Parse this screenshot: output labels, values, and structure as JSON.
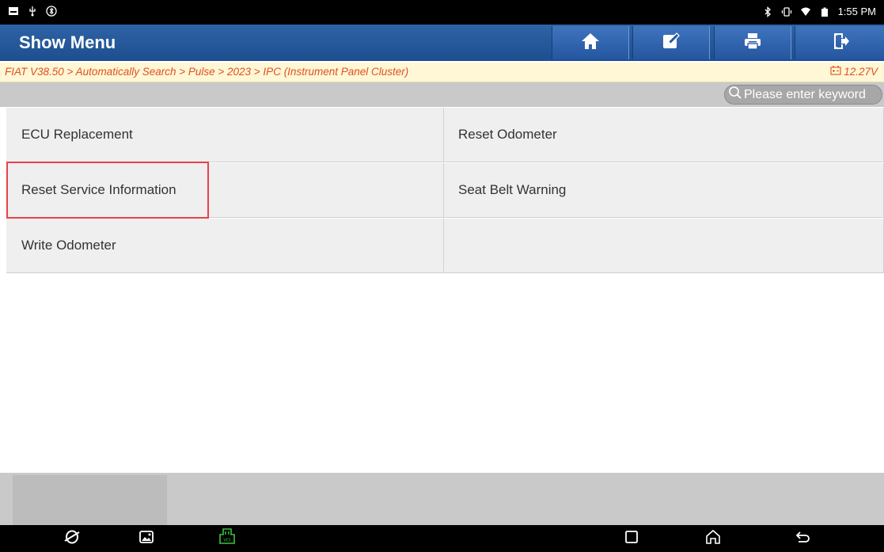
{
  "status_bar": {
    "time": "1:55 PM",
    "left_icons": [
      "notification-icon",
      "usb-icon",
      "bluetooth-circle-icon"
    ],
    "right_icons": [
      "bluetooth-icon",
      "vibrate-icon",
      "wifi-icon",
      "battery-icon"
    ]
  },
  "title_bar": {
    "title": "Show Menu",
    "buttons": [
      "home-icon",
      "edit-icon",
      "print-icon",
      "exit-icon"
    ]
  },
  "breadcrumb": {
    "path": "FIAT V38.50 > Automatically Search > Pulse > 2023 > IPC (Instrument Panel Cluster)",
    "voltage": "12.27V"
  },
  "search": {
    "placeholder": "Please enter keyword"
  },
  "menu": {
    "items": [
      "ECU Replacement",
      "Reset Odometer",
      "Reset Service Information",
      "Seat Belt Warning",
      "Write Odometer",
      ""
    ],
    "highlighted": "Reset Service Information"
  },
  "nav_bar": {
    "buttons": [
      "browser-icon",
      "gallery-icon",
      "vci-icon",
      "recent-apps-icon",
      "home-icon",
      "back-icon"
    ]
  },
  "colors": {
    "title_bar": "#1d4f8f",
    "breadcrumb_text": "#e0501e",
    "highlight_border": "#e8424a",
    "vci_icon": "#3cc43c"
  }
}
